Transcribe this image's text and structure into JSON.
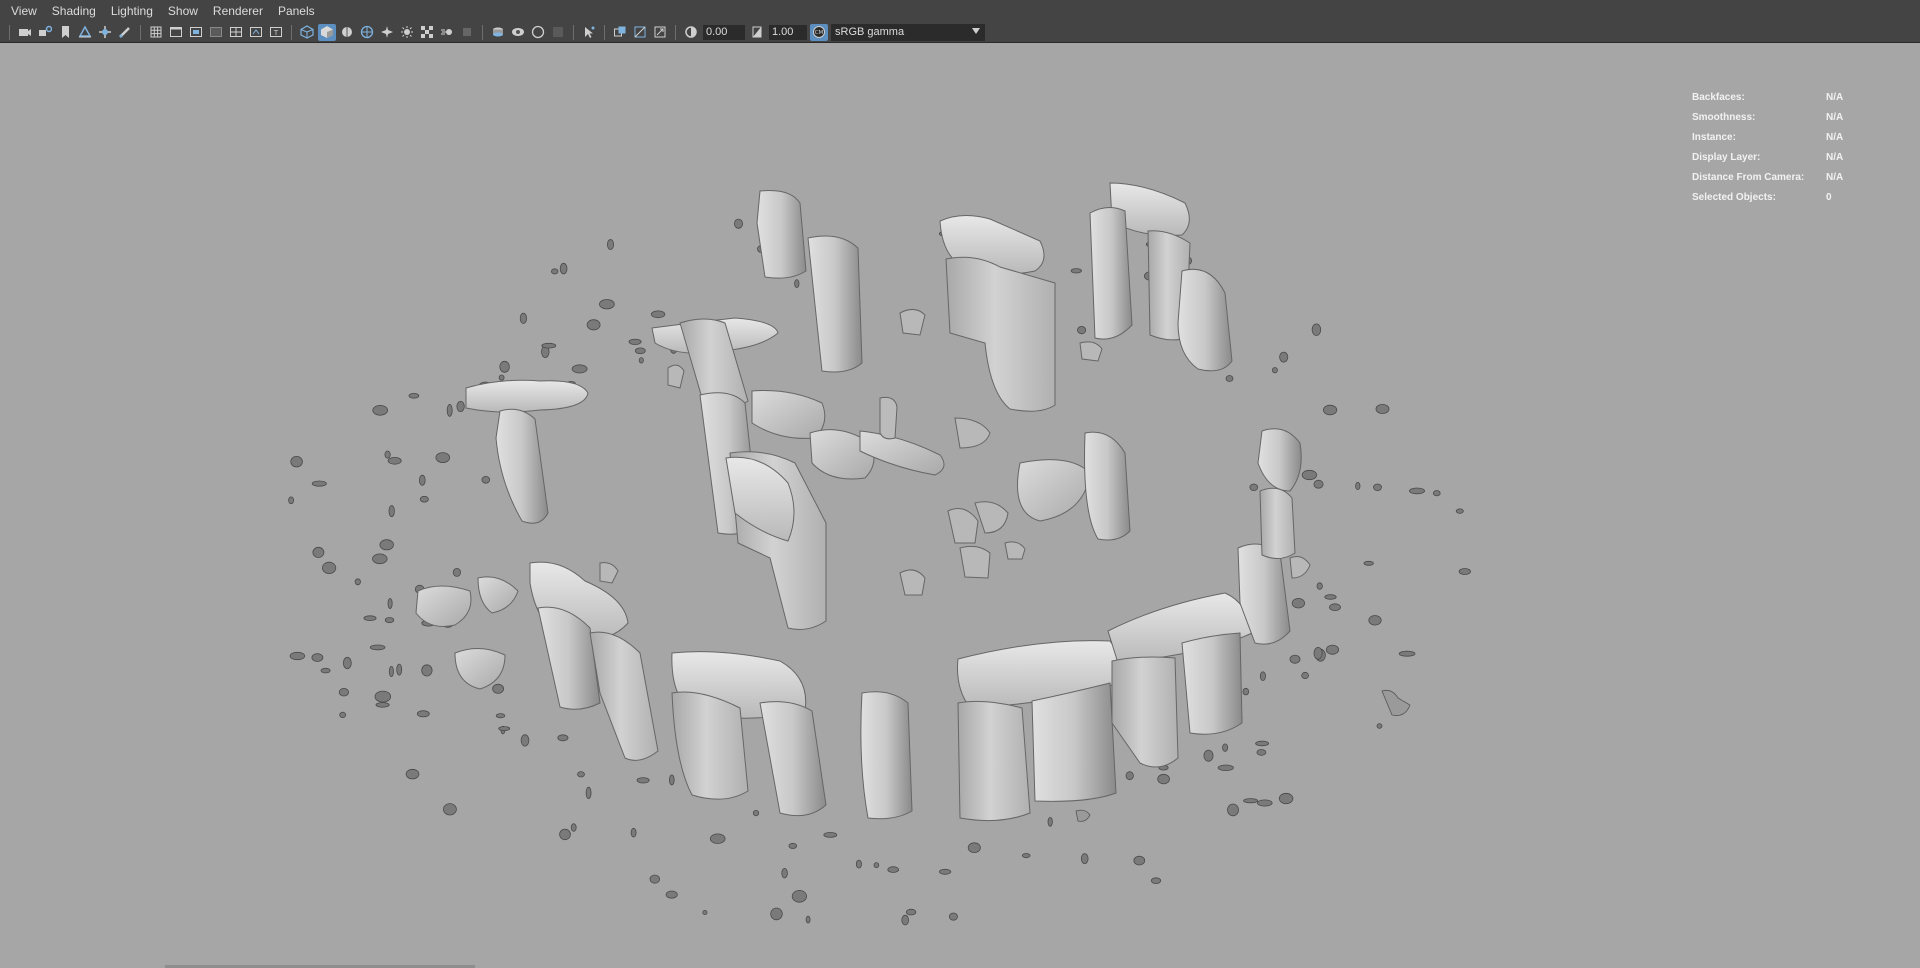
{
  "menu": [
    "View",
    "Shading",
    "Lighting",
    "Show",
    "Renderer",
    "Panels"
  ],
  "toolbar": {
    "exposure": "0.00",
    "gamma": "1.00",
    "color_space": "sRGB gamma",
    "icons": {
      "camera": "camera-icon",
      "camera_attr": "camera-attributes-icon",
      "bookmark": "bookmark-icon",
      "image_plane": "image-plane-icon",
      "pan_zoom": "pan-zoom-icon",
      "grease_pencil": "grease-pencil-icon",
      "grid": "grid-icon",
      "film_gate": "film-gate-icon",
      "resolution_gate": "resolution-gate-icon",
      "gate_mask": "gate-mask-icon",
      "field_chart": "field-chart-icon",
      "safe_action": "safe-action-icon",
      "safe_title": "safe-title-icon",
      "wireframe": "wireframe-icon",
      "smooth_shade": "smooth-shade-icon",
      "wireframe_on_shaded": "wireframe-on-shaded-icon",
      "textured": "textured-icon",
      "use_all_lights": "use-all-lights-icon",
      "shadows": "shadows-icon",
      "ssao": "ambient-occlusion-icon",
      "motion_blur": "motion-blur-icon",
      "anti_alias": "anti-alias-icon",
      "dof": "depth-of-field-icon",
      "isolate": "isolate-select-icon",
      "xray": "xray-icon",
      "xray_joints": "xray-joints-icon",
      "backface": "backface-culling-icon",
      "select_cam": "select-camera-icon",
      "two_sided": "two-sided-lighting-icon",
      "exposure": "exposure-icon",
      "gamma": "gamma-icon",
      "color_mgmt": "color-management-icon",
      "dropdown": "chevron-down-icon"
    }
  },
  "hud": [
    {
      "label": "Backfaces:",
      "value": "N/A"
    },
    {
      "label": "Smoothness:",
      "value": "N/A"
    },
    {
      "label": "Instance:",
      "value": "N/A"
    },
    {
      "label": "Display Layer:",
      "value": "N/A"
    },
    {
      "label": "Distance From Camera:",
      "value": "N/A"
    },
    {
      "label": "Selected Objects:",
      "value": "0"
    }
  ],
  "colors": {
    "viewport_bg": "#a6a6a6",
    "stone_light": "#d9d9d9",
    "stone_dark": "#6d6d6d",
    "active_button": "#5c8ec0"
  }
}
